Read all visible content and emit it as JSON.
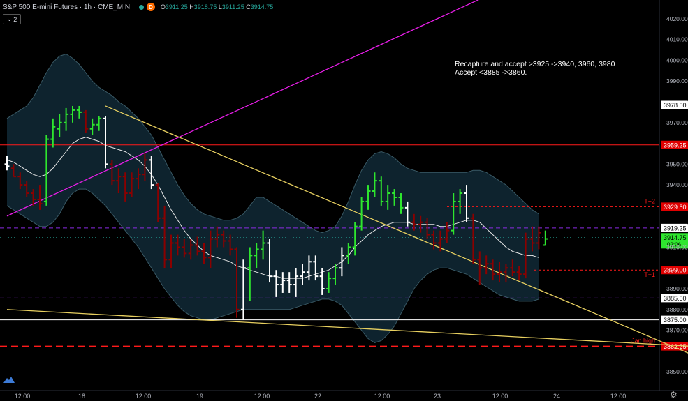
{
  "header": {
    "symbol": "S&P 500 E-mini Futures · 1h · CME_MINI",
    "badge": "D",
    "ohlc": [
      {
        "k": "O",
        "v": "3911.25"
      },
      {
        "k": "H",
        "v": "3918.75"
      },
      {
        "k": "L",
        "v": "3911.25"
      },
      {
        "k": "C",
        "v": "3914.75"
      }
    ],
    "collapse_label": "2"
  },
  "annotation": {
    "line1": "Recapture and accept >3925 ->3940, 3960, 3980",
    "line2": "Accept <3885 ->3860."
  },
  "colors": {
    "background": "#000000",
    "up_bar": "#2ee62e",
    "down_bar": "#8b0000",
    "neutral_bar": "#ffffff",
    "band_fill": "#0f2530",
    "band_edge": "#3a5a66",
    "magenta_line": "#e81ee8",
    "yellow_line": "#e8d060",
    "purple_dash": "#8a2be2",
    "red_level": "#ff1a1a"
  },
  "chart_data": {
    "type": "candlestick",
    "title": "S&P 500 E-mini Futures · 1h · CME_MINI",
    "ylim": [
      3845,
      4025
    ],
    "y_ticks": [
      3850,
      3860,
      3870,
      3880,
      3890,
      3900,
      3910,
      3920,
      3930,
      3940,
      3950,
      3960,
      3970,
      3980,
      3990,
      4000,
      4010,
      4020
    ],
    "x_ticks": [
      "12:00",
      "18",
      "12:00",
      "19",
      "12:00",
      "22",
      "12:00",
      "23",
      "12:00",
      "24",
      "12:00"
    ],
    "levels": [
      {
        "value": 3978.5,
        "label": "3978.50",
        "style": "solid",
        "color": "#cccccc"
      },
      {
        "value": 3959.25,
        "label": "3959.25",
        "style": "solid",
        "color": "#ff1a1a"
      },
      {
        "value": 3929.5,
        "label": "3929.50",
        "style": "dotted",
        "color": "#ff1a1a",
        "tag": "T+2"
      },
      {
        "value": 3919.25,
        "label": "3919.25",
        "style": "dashed",
        "color": "#8a2be2"
      },
      {
        "value": 3899.0,
        "label": "3899.00",
        "style": "dotted",
        "color": "#ff1a1a",
        "tag": "T+1"
      },
      {
        "value": 3885.5,
        "label": "3885.50",
        "style": "dashed",
        "color": "#8a2be2"
      },
      {
        "value": 3875.0,
        "label": "3875.00",
        "style": "solid",
        "color": "#ffffff"
      },
      {
        "value": 3862.25,
        "label": "3862.25",
        "style": "bolddash",
        "color": "#ff1a1a",
        "tag": "Jan high"
      }
    ],
    "last_price": {
      "value": 3914.75,
      "label": "3914.75",
      "countdown": "02:06"
    },
    "bars": [
      [
        3950,
        3954,
        3947,
        3949,
        "n"
      ],
      [
        3948,
        3950,
        3944,
        3944,
        "d"
      ],
      [
        3944,
        3946,
        3938,
        3940,
        "d"
      ],
      [
        3940,
        3942,
        3934,
        3936,
        "d"
      ],
      [
        3936,
        3938,
        3930,
        3933,
        "d"
      ],
      [
        3933,
        3940,
        3928,
        3931,
        "d"
      ],
      [
        3932,
        3964,
        3930,
        3962,
        "u"
      ],
      [
        3962,
        3972,
        3958,
        3968,
        "u"
      ],
      [
        3967,
        3974,
        3963,
        3970,
        "u"
      ],
      [
        3970,
        3977,
        3966,
        3974,
        "u"
      ],
      [
        3974,
        3978,
        3970,
        3976,
        "u"
      ],
      [
        3976,
        3978,
        3972,
        3975,
        "u"
      ],
      [
        3975,
        3976,
        3965,
        3967,
        "d"
      ],
      [
        3967,
        3972,
        3964,
        3969,
        "u"
      ],
      [
        3969,
        3973,
        3966,
        3972,
        "u"
      ],
      [
        3972,
        3973,
        3948,
        3950,
        "n"
      ],
      [
        3950,
        3952,
        3940,
        3942,
        "d"
      ],
      [
        3942,
        3948,
        3936,
        3944,
        "d"
      ],
      [
        3944,
        3946,
        3932,
        3936,
        "d"
      ],
      [
        3936,
        3946,
        3934,
        3943,
        "d"
      ],
      [
        3943,
        3948,
        3938,
        3945,
        "d"
      ],
      [
        3945,
        3955,
        3942,
        3952,
        "d"
      ],
      [
        3952,
        3954,
        3938,
        3940,
        "n"
      ],
      [
        3940,
        3941,
        3922,
        3924,
        "d"
      ],
      [
        3924,
        3930,
        3900,
        3904,
        "d"
      ],
      [
        3904,
        3916,
        3900,
        3912,
        "d"
      ],
      [
        3912,
        3916,
        3906,
        3910,
        "d"
      ],
      [
        3910,
        3914,
        3905,
        3907,
        "d"
      ],
      [
        3907,
        3914,
        3904,
        3911,
        "d"
      ],
      [
        3911,
        3915,
        3906,
        3908,
        "d"
      ],
      [
        3908,
        3912,
        3902,
        3905,
        "d"
      ],
      [
        3905,
        3918,
        3900,
        3914,
        "d"
      ],
      [
        3914,
        3920,
        3910,
        3916,
        "d"
      ],
      [
        3916,
        3918,
        3910,
        3913,
        "d"
      ],
      [
        3913,
        3916,
        3906,
        3909,
        "d"
      ],
      [
        3909,
        3910,
        3876,
        3880,
        "d"
      ],
      [
        3880,
        3904,
        3875,
        3900,
        "n"
      ],
      [
        3900,
        3910,
        3884,
        3906,
        "u"
      ],
      [
        3906,
        3912,
        3900,
        3909,
        "u"
      ],
      [
        3909,
        3918,
        3904,
        3912,
        "u"
      ],
      [
        3912,
        3914,
        3893,
        3896,
        "n"
      ],
      [
        3896,
        3899,
        3886,
        3892,
        "n"
      ],
      [
        3892,
        3898,
        3888,
        3894,
        "n"
      ],
      [
        3894,
        3898,
        3888,
        3892,
        "n"
      ],
      [
        3892,
        3900,
        3886,
        3896,
        "n"
      ],
      [
        3896,
        3902,
        3892,
        3898,
        "n"
      ],
      [
        3898,
        3906,
        3894,
        3903,
        "n"
      ],
      [
        3903,
        3906,
        3894,
        3896,
        "n"
      ],
      [
        3896,
        3900,
        3887,
        3890,
        "n"
      ],
      [
        3890,
        3898,
        3888,
        3895,
        "u"
      ],
      [
        3895,
        3902,
        3892,
        3900,
        "u"
      ],
      [
        3900,
        3910,
        3896,
        3906,
        "n"
      ],
      [
        3906,
        3912,
        3902,
        3910,
        "u"
      ],
      [
        3910,
        3922,
        3906,
        3920,
        "u"
      ],
      [
        3920,
        3934,
        3918,
        3932,
        "u"
      ],
      [
        3932,
        3940,
        3928,
        3937,
        "u"
      ],
      [
        3937,
        3946,
        3934,
        3942,
        "u"
      ],
      [
        3942,
        3944,
        3930,
        3932,
        "u"
      ],
      [
        3932,
        3940,
        3928,
        3936,
        "u"
      ],
      [
        3936,
        3938,
        3930,
        3934,
        "u"
      ],
      [
        3934,
        3936,
        3926,
        3929,
        "u"
      ],
      [
        3929,
        3932,
        3920,
        3922,
        "n"
      ],
      [
        3922,
        3926,
        3918,
        3921,
        "d"
      ],
      [
        3921,
        3925,
        3917,
        3922,
        "d"
      ],
      [
        3922,
        3924,
        3914,
        3916,
        "d"
      ],
      [
        3916,
        3918,
        3909,
        3912,
        "d"
      ],
      [
        3912,
        3918,
        3908,
        3914,
        "d"
      ],
      [
        3914,
        3922,
        3912,
        3918,
        "d"
      ],
      [
        3918,
        3936,
        3916,
        3932,
        "u"
      ],
      [
        3932,
        3938,
        3926,
        3936,
        "u"
      ],
      [
        3936,
        3940,
        3922,
        3924,
        "n"
      ],
      [
        3924,
        3926,
        3902,
        3904,
        "d"
      ],
      [
        3904,
        3908,
        3892,
        3900,
        "d"
      ],
      [
        3900,
        3906,
        3897,
        3902,
        "d"
      ],
      [
        3902,
        3904,
        3894,
        3897,
        "d"
      ],
      [
        3897,
        3903,
        3893,
        3898,
        "d"
      ],
      [
        3898,
        3902,
        3893,
        3900,
        "d"
      ],
      [
        3900,
        3904,
        3896,
        3898,
        "d"
      ],
      [
        3898,
        3901,
        3894,
        3897,
        "d"
      ],
      [
        3897,
        3917,
        3895,
        3914,
        "d"
      ],
      [
        3914,
        3920,
        3908,
        3912,
        "d"
      ],
      [
        3912,
        3920,
        3909,
        3917,
        "d"
      ],
      [
        3911,
        3918,
        3911,
        3914,
        "u"
      ]
    ],
    "sma_mid": [
      3952,
      3951,
      3949,
      3947,
      3945,
      3944,
      3945,
      3948,
      3952,
      3956,
      3960,
      3962,
      3963,
      3962,
      3961,
      3959,
      3958,
      3957,
      3956,
      3954,
      3952,
      3949,
      3945,
      3940,
      3934,
      3928,
      3923,
      3918,
      3914,
      3911,
      3908,
      3906,
      3905,
      3904,
      3903,
      3901,
      3900,
      3899,
      3898,
      3897,
      3896,
      3896,
      3895,
      3895,
      3895,
      3895,
      3896,
      3897,
      3898,
      3899,
      3901,
      3903,
      3906,
      3910,
      3913,
      3916,
      3918,
      3920,
      3921,
      3922,
      3922,
      3922,
      3921,
      3921,
      3921,
      3921,
      3920,
      3920,
      3921,
      3922,
      3923,
      3923,
      3922,
      3919,
      3916,
      3913,
      3910,
      3908,
      3907,
      3906,
      3906,
      3905
    ],
    "band_upper": [
      3972,
      3974,
      3976,
      3978,
      3982,
      3988,
      3994,
      3999,
      4002,
      4003,
      4001,
      3998,
      3994,
      3990,
      3987,
      3985,
      3983,
      3980,
      3978,
      3975,
      3972,
      3968,
      3964,
      3958,
      3952,
      3946,
      3940,
      3935,
      3931,
      3928,
      3926,
      3925,
      3924,
      3923,
      3923,
      3924,
      3926,
      3930,
      3934,
      3934,
      3932,
      3930,
      3928,
      3926,
      3924,
      3922,
      3920,
      3918,
      3917,
      3918,
      3920,
      3925,
      3932,
      3940,
      3947,
      3952,
      3955,
      3956,
      3955,
      3953,
      3950,
      3948,
      3947,
      3946,
      3946,
      3946,
      3946,
      3946,
      3946,
      3946,
      3946,
      3947,
      3947,
      3946,
      3944,
      3942,
      3940,
      3937,
      3934,
      3931,
      3928,
      3926
    ],
    "band_lower": [
      3930,
      3928,
      3926,
      3924,
      3922,
      3920,
      3920,
      3922,
      3926,
      3932,
      3936,
      3938,
      3938,
      3936,
      3933,
      3930,
      3926,
      3922,
      3918,
      3914,
      3910,
      3905,
      3900,
      3895,
      3890,
      3886,
      3882,
      3879,
      3877,
      3876,
      3875,
      3875,
      3876,
      3877,
      3878,
      3879,
      3880,
      3880,
      3880,
      3880,
      3880,
      3880,
      3880,
      3880,
      3881,
      3882,
      3883,
      3884,
      3885,
      3885,
      3884,
      3882,
      3878,
      3874,
      3870,
      3866,
      3864,
      3865,
      3868,
      3872,
      3878,
      3884,
      3890,
      3894,
      3897,
      3899,
      3900,
      3900,
      3899,
      3898,
      3897,
      3895,
      3893,
      3891,
      3889,
      3887,
      3886,
      3885,
      3884,
      3884,
      3884,
      3885
    ],
    "trendlines": [
      {
        "name": "magenta",
        "points": [
          [
            "bar0",
            3925
          ],
          [
            "bar100",
            4070
          ]
        ]
      },
      {
        "name": "yellow-upper",
        "points": [
          [
            "bar15",
            3978
          ],
          [
            "bar112",
            3848
          ]
        ]
      },
      {
        "name": "yellow-lower",
        "points": [
          [
            "bar0",
            3880
          ],
          [
            "bar112",
            3861
          ]
        ]
      }
    ]
  }
}
